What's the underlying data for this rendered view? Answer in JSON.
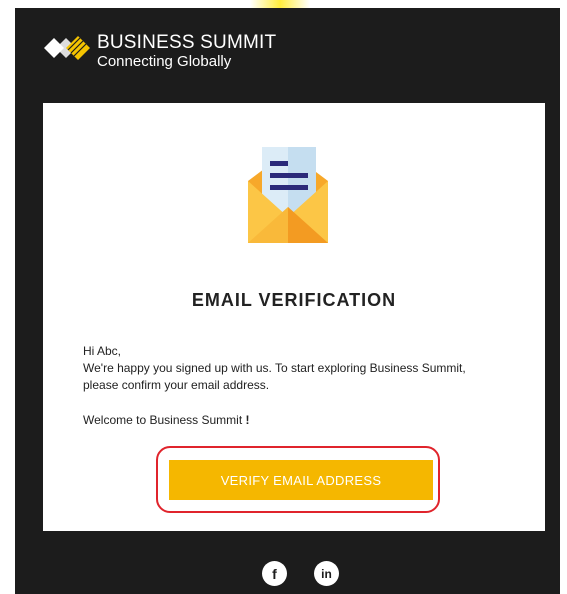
{
  "header": {
    "brand_name": "BUSINESS SUMMIT",
    "tagline": "Connecting Globally"
  },
  "card": {
    "title": "EMAIL VERIFICATION",
    "greeting": "Hi Abc,",
    "message": "We're happy you signed up with us. To start exploring Business Summit, please confirm your email address.",
    "welcome_text": "Welcome to Business Summit",
    "welcome_mark": "!",
    "verify_button_label": "VERIFY EMAIL ADDRESS"
  },
  "footer": {
    "social_icons": [
      "facebook-icon",
      "linkedin-icon"
    ],
    "facebook_glyph": "f",
    "linkedin_glyph": "in"
  },
  "colors": {
    "background": "#1c1c1c",
    "card": "#ffffff",
    "accent": "#f5b700",
    "highlight": "#e0242c"
  }
}
